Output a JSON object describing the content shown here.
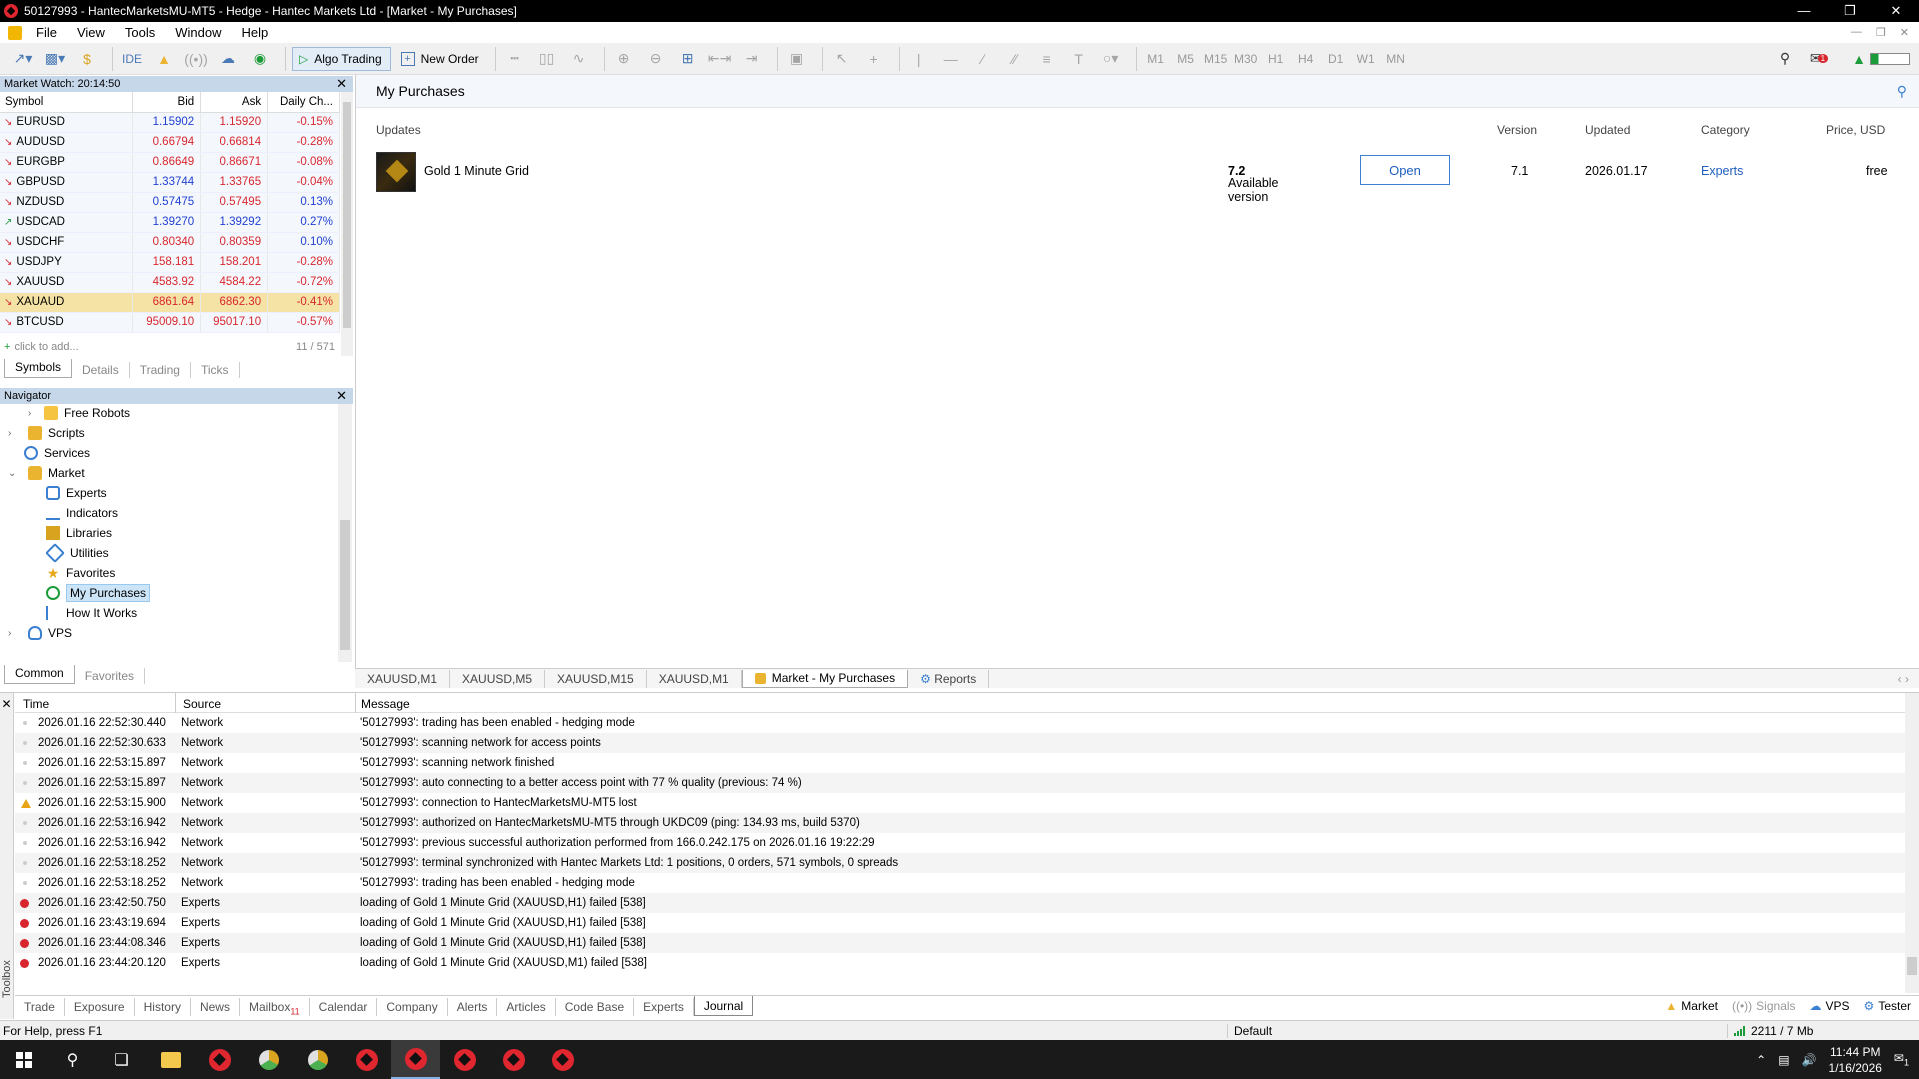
{
  "window": {
    "title": "50127993 - HantecMarketsMU-MT5 - Hedge - Hantec Markets Ltd - [Market - My Purchases]"
  },
  "menu": [
    "File",
    "View",
    "Tools",
    "Window",
    "Help"
  ],
  "toolbar": {
    "ide": "IDE",
    "algo_trading": "Algo Trading",
    "new_order": "New Order",
    "timeframes": [
      "M1",
      "M5",
      "M15",
      "M30",
      "H1",
      "H4",
      "D1",
      "W1",
      "MN"
    ],
    "notif_count": "1"
  },
  "market_watch": {
    "title": "Market Watch: 20:14:50",
    "columns": [
      "Symbol",
      "Bid",
      "Ask",
      "Daily Ch..."
    ],
    "rows": [
      {
        "symbol": "EURUSD",
        "bid": "1.15902",
        "ask": "1.15920",
        "change": "-0.15%",
        "dir": "down",
        "bid_color": "blue",
        "ask_color": "red"
      },
      {
        "symbol": "AUDUSD",
        "bid": "0.66794",
        "ask": "0.66814",
        "change": "-0.28%",
        "dir": "down",
        "bid_color": "red",
        "ask_color": "red"
      },
      {
        "symbol": "EURGBP",
        "bid": "0.86649",
        "ask": "0.86671",
        "change": "-0.08%",
        "dir": "down",
        "bid_color": "red",
        "ask_color": "red"
      },
      {
        "symbol": "GBPUSD",
        "bid": "1.33744",
        "ask": "1.33765",
        "change": "-0.04%",
        "dir": "down",
        "bid_color": "blue",
        "ask_color": "red"
      },
      {
        "symbol": "NZDUSD",
        "bid": "0.57475",
        "ask": "0.57495",
        "change": "0.13%",
        "dir": "down",
        "bid_color": "blue",
        "ask_color": "red"
      },
      {
        "symbol": "USDCAD",
        "bid": "1.39270",
        "ask": "1.39292",
        "change": "0.27%",
        "dir": "up",
        "bid_color": "blue",
        "ask_color": "blue"
      },
      {
        "symbol": "USDCHF",
        "bid": "0.80340",
        "ask": "0.80359",
        "change": "0.10%",
        "dir": "down",
        "bid_color": "red",
        "ask_color": "red"
      },
      {
        "symbol": "USDJPY",
        "bid": "158.181",
        "ask": "158.201",
        "change": "-0.28%",
        "dir": "down",
        "bid_color": "red",
        "ask_color": "red"
      },
      {
        "symbol": "XAUUSD",
        "bid": "4583.92",
        "ask": "4584.22",
        "change": "-0.72%",
        "dir": "down",
        "bid_color": "red",
        "ask_color": "red"
      },
      {
        "symbol": "XAUAUD",
        "bid": "6861.64",
        "ask": "6862.30",
        "change": "-0.41%",
        "dir": "down",
        "bid_color": "red",
        "ask_color": "red"
      },
      {
        "symbol": "BTCUSD",
        "bid": "95009.10",
        "ask": "95017.10",
        "change": "-0.57%",
        "dir": "down",
        "bid_color": "red",
        "ask_color": "red"
      }
    ],
    "add_text": "click to add...",
    "count": "11 / 571",
    "tabs": [
      "Symbols",
      "Details",
      "Trading",
      "Ticks"
    ]
  },
  "navigator": {
    "title": "Navigator",
    "items": [
      {
        "label": "Free Robots",
        "icon": "folder-icon"
      },
      {
        "label": "Scripts",
        "icon": "script-icon"
      },
      {
        "label": "Services",
        "icon": "gear-icon"
      },
      {
        "label": "Market",
        "icon": "shopping-bag-icon"
      },
      {
        "label": "Experts",
        "icon": "expert-icon"
      },
      {
        "label": "Indicators",
        "icon": "indicator-icon"
      },
      {
        "label": "Libraries",
        "icon": "library-icon"
      },
      {
        "label": "Utilities",
        "icon": "utility-icon"
      },
      {
        "label": "Favorites",
        "icon": "star-icon"
      },
      {
        "label": "My Purchases",
        "icon": "check-circle-icon"
      },
      {
        "label": "How It Works",
        "icon": "document-icon"
      },
      {
        "label": "VPS",
        "icon": "cloud-icon"
      }
    ],
    "tabs": [
      "Common",
      "Favorites"
    ]
  },
  "purchases": {
    "title": "My Purchases",
    "headers": {
      "updates": "Updates",
      "version": "Version",
      "updated": "Updated",
      "category": "Category",
      "price": "Price, USD"
    },
    "product": {
      "name": "Gold 1 Minute Grid",
      "available_label": "Available version",
      "available_version": "7.2",
      "open_label": "Open",
      "version": "7.1",
      "updated": "2026.01.17",
      "category": "Experts",
      "price": "free"
    }
  },
  "chart_tabs": [
    "XAUUSD,M1",
    "XAUUSD,M5",
    "XAUUSD,M15",
    "XAUUSD,M1",
    "Market - My Purchases",
    "Reports"
  ],
  "journal": {
    "columns": [
      "Time",
      "Source",
      "Message"
    ],
    "rows": [
      {
        "level": "info",
        "time": "2026.01.16 22:52:30.440",
        "source": "Network",
        "message": "'50127993': trading has been enabled - hedging mode"
      },
      {
        "level": "info",
        "time": "2026.01.16 22:52:30.633",
        "source": "Network",
        "message": "'50127993': scanning network for access points"
      },
      {
        "level": "info",
        "time": "2026.01.16 22:53:15.897",
        "source": "Network",
        "message": "'50127993': scanning network finished"
      },
      {
        "level": "info",
        "time": "2026.01.16 22:53:15.897",
        "source": "Network",
        "message": "'50127993': auto connecting to a better access point with 77 % quality (previous: 74 %)"
      },
      {
        "level": "warn",
        "time": "2026.01.16 22:53:15.900",
        "source": "Network",
        "message": "'50127993': connection to HantecMarketsMU-MT5 lost"
      },
      {
        "level": "info",
        "time": "2026.01.16 22:53:16.942",
        "source": "Network",
        "message": "'50127993': authorized on HantecMarketsMU-MT5 through UKDC09 (ping: 134.93 ms, build 5370)"
      },
      {
        "level": "info",
        "time": "2026.01.16 22:53:16.942",
        "source": "Network",
        "message": "'50127993': previous successful authorization performed from 166.0.242.175 on 2026.01.16 19:22:29"
      },
      {
        "level": "info",
        "time": "2026.01.16 22:53:18.252",
        "source": "Network",
        "message": "'50127993': terminal synchronized with Hantec Markets Ltd: 1 positions, 0 orders, 571 symbols, 0 spreads"
      },
      {
        "level": "info",
        "time": "2026.01.16 22:53:18.252",
        "source": "Network",
        "message": "'50127993': trading has been enabled - hedging mode"
      },
      {
        "level": "err",
        "time": "2026.01.16 23:42:50.750",
        "source": "Experts",
        "message": "loading of Gold 1 Minute Grid (XAUUSD,H1) failed [538]"
      },
      {
        "level": "err",
        "time": "2026.01.16 23:43:19.694",
        "source": "Experts",
        "message": "loading of Gold 1 Minute Grid (XAUUSD,H1) failed [538]"
      },
      {
        "level": "err",
        "time": "2026.01.16 23:44:08.346",
        "source": "Experts",
        "message": "loading of Gold 1 Minute Grid (XAUUSD,H1) failed [538]"
      },
      {
        "level": "err",
        "time": "2026.01.16 23:44:20.120",
        "source": "Experts",
        "message": "loading of Gold 1 Minute Grid (XAUUSD,M1) failed [538]"
      }
    ]
  },
  "toolbox": {
    "side_label": "Toolbox",
    "tabs": [
      "Trade",
      "Exposure",
      "History",
      "News",
      "Mailbox",
      "Calendar",
      "Company",
      "Alerts",
      "Articles",
      "Code Base",
      "Experts",
      "Journal"
    ],
    "mailbox_count": "11",
    "right": [
      "Market",
      "Signals",
      "VPS",
      "Tester"
    ]
  },
  "status": {
    "help": "For Help, press F1",
    "profile": "Default",
    "traffic": "2211 / 7 Mb"
  },
  "taskbar": {
    "time": "11:44 PM",
    "date": "1/16/2026",
    "notif": "1"
  }
}
